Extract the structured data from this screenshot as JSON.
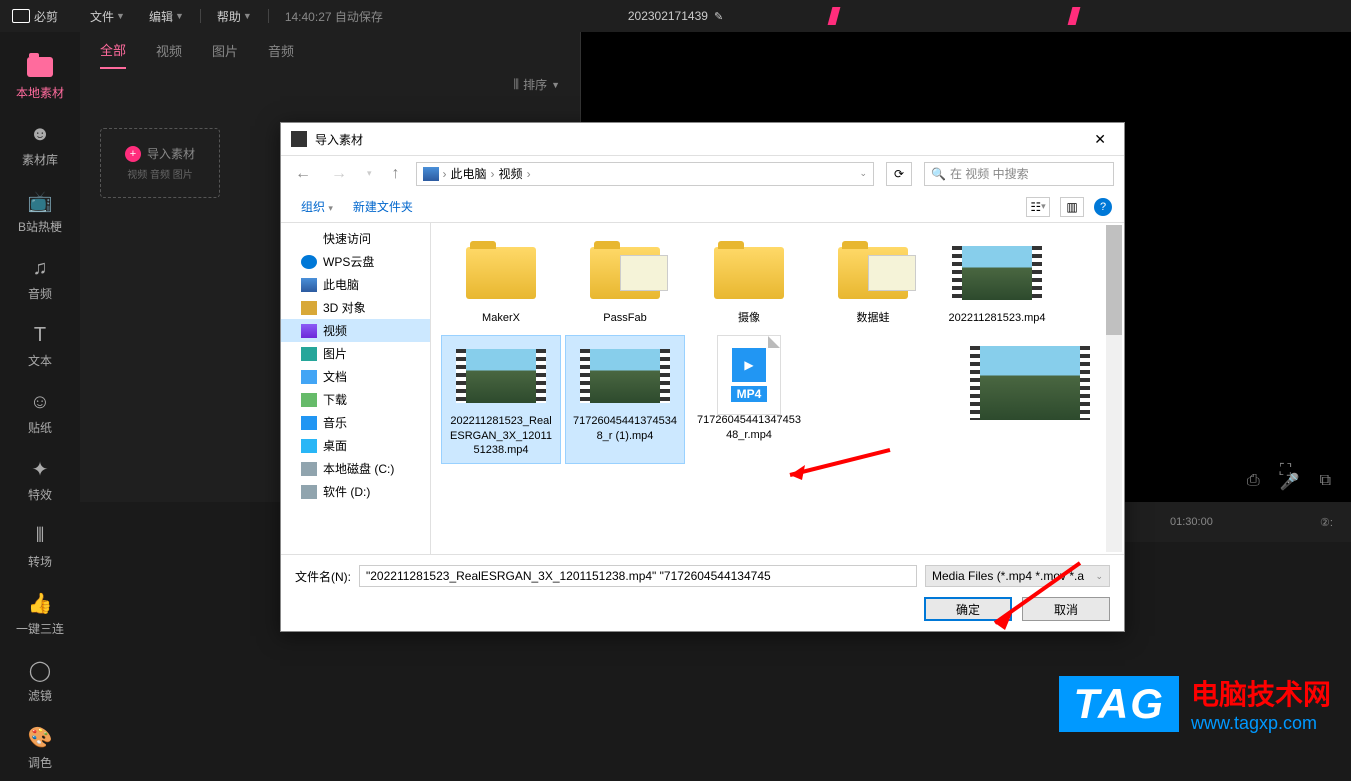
{
  "topbar": {
    "appName": "必剪",
    "menus": {
      "file": "文件",
      "edit": "编辑",
      "help": "帮助"
    },
    "time": "14:40:27",
    "autosave": "自动保存",
    "projectName": "202302171439"
  },
  "sidebar": {
    "items": [
      {
        "label": "本地素材"
      },
      {
        "label": "素材库"
      },
      {
        "label": "B站热梗"
      },
      {
        "label": "音频"
      },
      {
        "label": "文本"
      },
      {
        "label": "贴纸"
      },
      {
        "label": "特效"
      },
      {
        "label": "转场"
      },
      {
        "label": "一键三连"
      },
      {
        "label": "滤镜"
      },
      {
        "label": "调色"
      }
    ]
  },
  "panel": {
    "tabs": {
      "all": "全部",
      "video": "视频",
      "image": "图片",
      "audio": "音频"
    },
    "sort": "排序",
    "import": {
      "label": "导入素材",
      "sub": "视频 音频 图片"
    }
  },
  "timeline": {
    "marks": [
      "01:30:00",
      "②:"
    ]
  },
  "dialog": {
    "title": "导入素材",
    "breadcrumb": {
      "pc": "此电脑",
      "folder": "视频"
    },
    "searchPlaceholder": "在 视频 中搜索",
    "toolbar": {
      "organize": "组织",
      "newFolder": "新建文件夹"
    },
    "tree": [
      {
        "label": "快速访问",
        "icon": "star"
      },
      {
        "label": "WPS云盘",
        "icon": "wps"
      },
      {
        "label": "此电脑",
        "icon": "pc"
      },
      {
        "label": "3D 对象",
        "icon": "folder3d"
      },
      {
        "label": "视频",
        "icon": "video",
        "selected": true
      },
      {
        "label": "图片",
        "icon": "img"
      },
      {
        "label": "文档",
        "icon": "doc"
      },
      {
        "label": "下载",
        "icon": "download"
      },
      {
        "label": "音乐",
        "icon": "music"
      },
      {
        "label": "桌面",
        "icon": "desktop"
      },
      {
        "label": "本地磁盘 (C:)",
        "icon": "drive"
      },
      {
        "label": "软件 (D:)",
        "icon": "drive"
      }
    ],
    "files": [
      {
        "name": "MakerX",
        "type": "folder"
      },
      {
        "name": "PassFab",
        "type": "folder-preview"
      },
      {
        "name": "摄像",
        "type": "folder"
      },
      {
        "name": "数据蛙",
        "type": "folder-preview"
      },
      {
        "name": "202211281523.mp4",
        "type": "video"
      },
      {
        "name": "202211281523_RealESRGAN_3X_1201151238.mp4",
        "type": "video",
        "selected": true
      },
      {
        "name": "717260454413745348_r (1).mp4",
        "type": "video",
        "selected": true
      },
      {
        "name": "7172604544134745348_r.mp4",
        "type": "mp4icon"
      }
    ],
    "mp4Badge": "MP4",
    "fnLabel": "文件名(N):",
    "fnValue": "\"202211281523_RealESRGAN_3X_1201151238.mp4\" \"7172604544134745",
    "filter": "Media Files (*.mp4 *.mov *.a",
    "ok": "确定",
    "cancel": "取消"
  },
  "watermark": {
    "tag": "TAG",
    "cn": "电脑技术网",
    "url": "www.tagxp.com"
  }
}
